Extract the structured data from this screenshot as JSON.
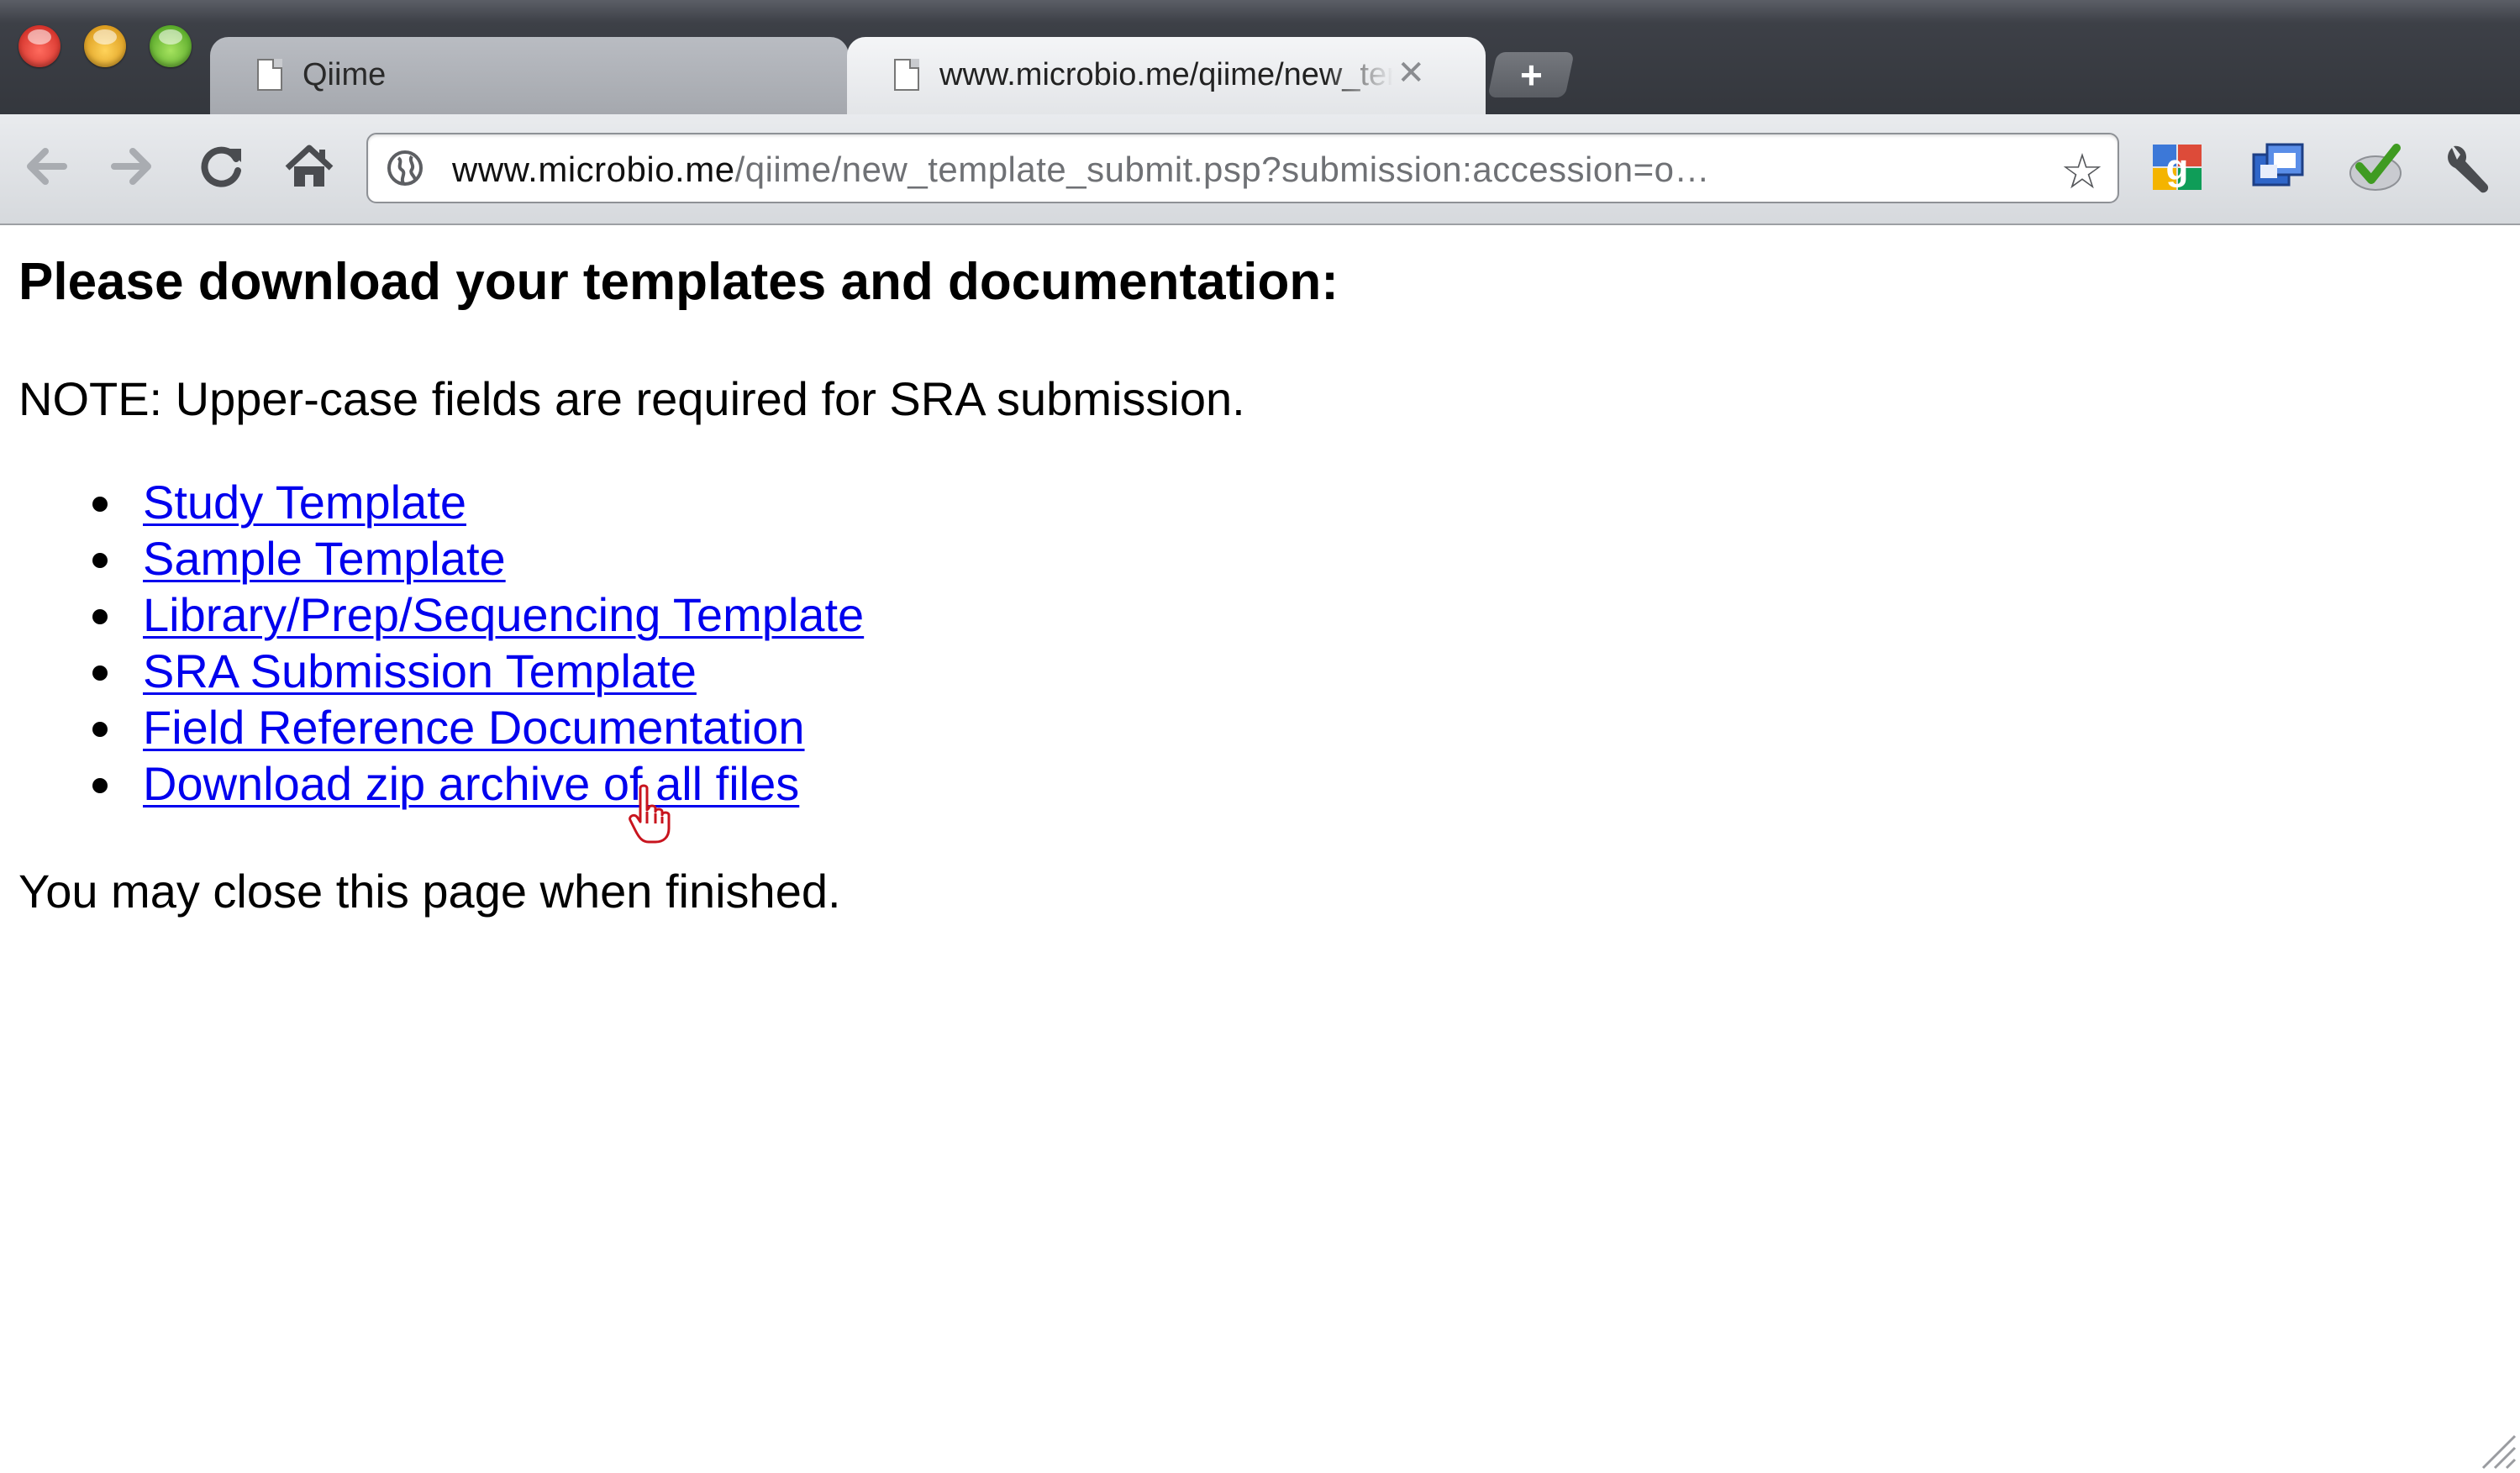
{
  "browser": {
    "tabs": [
      {
        "title": "Qiime",
        "active": false
      },
      {
        "title": "www.microbio.me/qiime/new_template_submit.psp",
        "active": true
      }
    ],
    "new_tab_label": "+",
    "toolbar": {
      "back_icon": "back-arrow-icon",
      "forward_icon": "forward-arrow-icon",
      "reload_icon": "reload-icon",
      "home_icon": "home-icon"
    },
    "address": {
      "host": "www.microbio.me",
      "path": "/qiime/new_template_submit.psp?submission:accession=o…"
    },
    "extensions": [
      "google-extension-icon",
      "window-extension-icon",
      "checkmark-extension-icon"
    ],
    "menu_icon": "wrench-icon"
  },
  "page": {
    "heading": "Please download your templates and documentation:",
    "note": "NOTE: Upper-case fields are required for SRA submission.",
    "links": [
      {
        "label": "Study Template"
      },
      {
        "label": "Sample Template"
      },
      {
        "label": "Library/Prep/Sequencing Template"
      },
      {
        "label": "SRA Submission Template"
      },
      {
        "label": "Field Reference Documentation"
      },
      {
        "label": "Download zip archive of all files"
      }
    ],
    "closing": "You may close this page when finished."
  },
  "colors": {
    "link": "#0000ee",
    "tabstrip": "#3d4047",
    "toolbar": "#e0e2e5"
  }
}
